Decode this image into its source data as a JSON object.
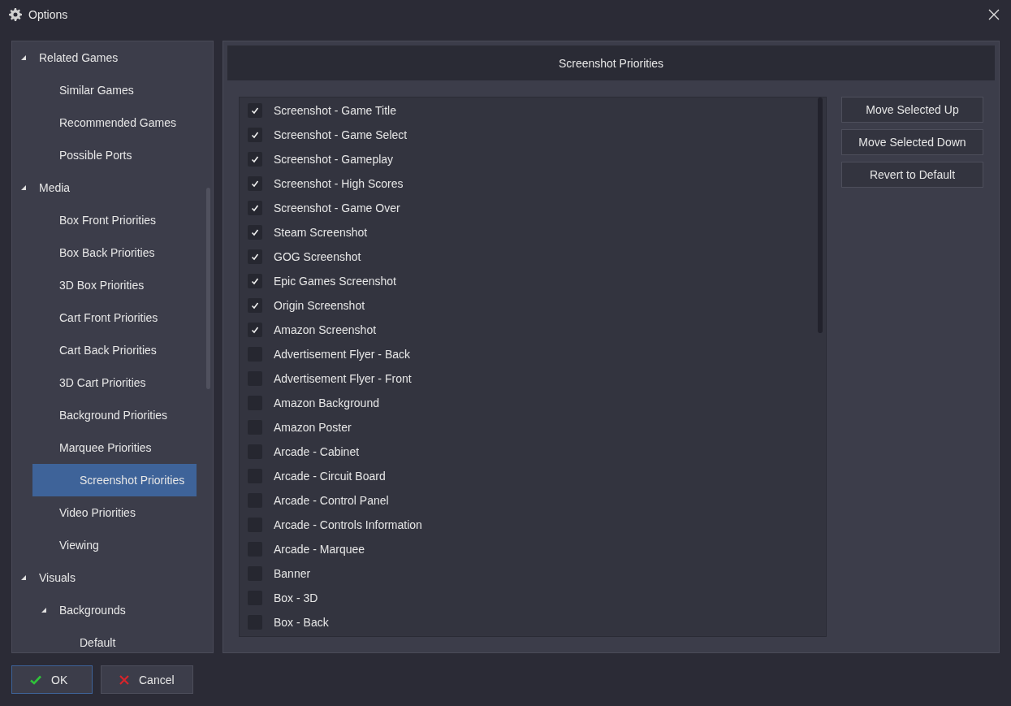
{
  "window": {
    "title": "Options"
  },
  "tree": [
    {
      "label": "Related Games",
      "expanded": true,
      "selected": false,
      "children": [
        {
          "label": "Similar Games",
          "selected": false
        },
        {
          "label": "Recommended Games",
          "selected": false
        },
        {
          "label": "Possible Ports",
          "selected": false
        }
      ]
    },
    {
      "label": "Media",
      "expanded": true,
      "selected": false,
      "children": [
        {
          "label": "Box Front Priorities",
          "selected": false
        },
        {
          "label": "Box Back Priorities",
          "selected": false
        },
        {
          "label": "3D Box Priorities",
          "selected": false
        },
        {
          "label": "Cart Front Priorities",
          "selected": false
        },
        {
          "label": "Cart Back Priorities",
          "selected": false
        },
        {
          "label": "3D Cart Priorities",
          "selected": false
        },
        {
          "label": "Background Priorities",
          "selected": false
        },
        {
          "label": "Marquee Priorities",
          "selected": false
        },
        {
          "label": "Screenshot Priorities",
          "selected": true
        },
        {
          "label": "Video Priorities",
          "selected": false
        },
        {
          "label": "Viewing",
          "selected": false
        }
      ]
    },
    {
      "label": "Visuals",
      "expanded": true,
      "selected": false,
      "children": [
        {
          "label": "Backgrounds",
          "expanded": true,
          "selected": false,
          "children": [
            {
              "label": "Default",
              "selected": false
            }
          ]
        }
      ]
    }
  ],
  "section_title": "Screenshot Priorities",
  "priorities": [
    {
      "label": "Screenshot - Game Title",
      "checked": true
    },
    {
      "label": "Screenshot - Game Select",
      "checked": true
    },
    {
      "label": "Screenshot - Gameplay",
      "checked": true
    },
    {
      "label": "Screenshot - High Scores",
      "checked": true
    },
    {
      "label": "Screenshot - Game Over",
      "checked": true
    },
    {
      "label": "Steam Screenshot",
      "checked": true
    },
    {
      "label": "GOG Screenshot",
      "checked": true
    },
    {
      "label": "Epic Games Screenshot",
      "checked": true
    },
    {
      "label": "Origin Screenshot",
      "checked": true
    },
    {
      "label": "Amazon Screenshot",
      "checked": true
    },
    {
      "label": "Advertisement Flyer - Back",
      "checked": false
    },
    {
      "label": "Advertisement Flyer - Front",
      "checked": false
    },
    {
      "label": "Amazon Background",
      "checked": false
    },
    {
      "label": "Amazon Poster",
      "checked": false
    },
    {
      "label": "Arcade - Cabinet",
      "checked": false
    },
    {
      "label": "Arcade - Circuit Board",
      "checked": false
    },
    {
      "label": "Arcade - Control Panel",
      "checked": false
    },
    {
      "label": "Arcade - Controls Information",
      "checked": false
    },
    {
      "label": "Arcade - Marquee",
      "checked": false
    },
    {
      "label": "Banner",
      "checked": false
    },
    {
      "label": "Box - 3D",
      "checked": false
    },
    {
      "label": "Box - Back",
      "checked": false
    }
  ],
  "side_buttons": [
    "Move Selected Up",
    "Move Selected Down",
    "Revert to Default"
  ],
  "footer_buttons": [
    {
      "label": "OK",
      "kind": "ok"
    },
    {
      "label": "Cancel",
      "kind": "cancel"
    }
  ]
}
